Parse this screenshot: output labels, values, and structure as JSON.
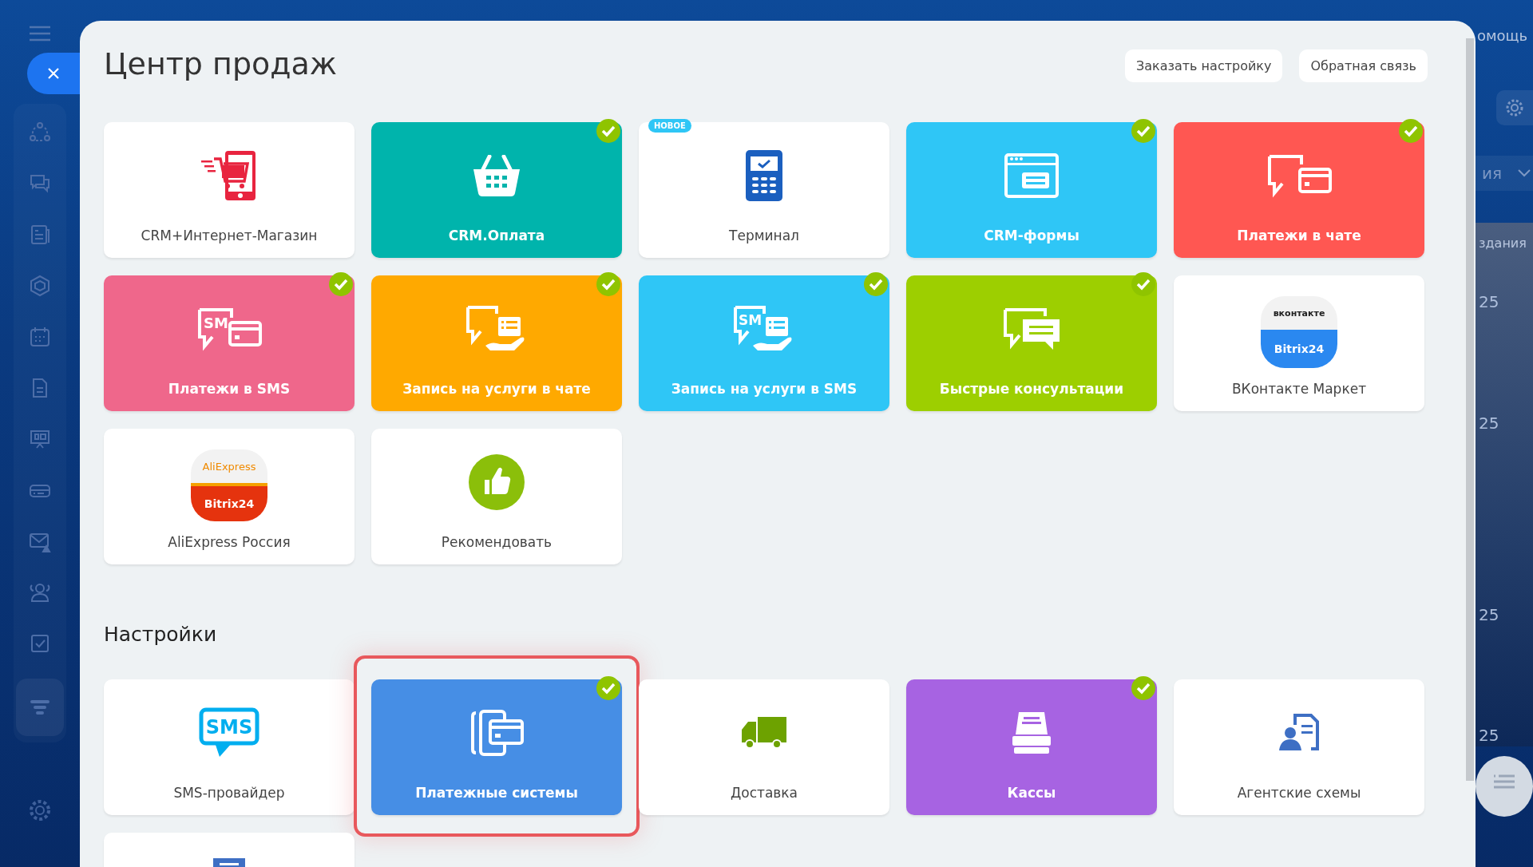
{
  "background": {
    "help_label": "омощь",
    "filter_label": "ия",
    "column_label": "здания",
    "dates": [
      "25",
      "25",
      "25",
      "25"
    ]
  },
  "sidebar": {
    "items": [
      {
        "selected": false
      },
      {
        "selected": false
      },
      {
        "selected": false
      },
      {
        "selected": false
      },
      {
        "selected": false
      },
      {
        "selected": false
      },
      {
        "selected": false
      },
      {
        "selected": false
      },
      {
        "selected": false
      },
      {
        "selected": false
      },
      {
        "selected": false
      },
      {
        "selected": true
      }
    ]
  },
  "panel": {
    "title": "Центр продаж",
    "buttons": [
      "Заказать настройку",
      "Обратная связь"
    ]
  },
  "sales": {
    "tiles": [
      {
        "label": "CRM+Интернет-Магазин",
        "color": "#ffffff",
        "checked": false
      },
      {
        "label": "CRM.Оплата",
        "color": "#00b4ac",
        "checked": true
      },
      {
        "label": "Терминал",
        "color": "#ffffff",
        "checked": false,
        "badge": "НОВОЕ"
      },
      {
        "label": "CRM-формы",
        "color": "#2fc6f6",
        "checked": true
      },
      {
        "label": "Платежи в чате",
        "color": "#ff5752",
        "checked": true
      },
      {
        "label": "Платежи в SMS",
        "color": "#ef678b",
        "checked": true,
        "icon_text": "SM"
      },
      {
        "label": "Запись на услуги в чате",
        "color": "#ffa900",
        "checked": true
      },
      {
        "label": "Запись на услуги в SMS",
        "color": "#2fc6f6",
        "checked": true,
        "icon_text": "SM"
      },
      {
        "label": "Быстрые консультации",
        "color": "#9dcf00",
        "checked": true
      },
      {
        "label": "ВКонтакте Маркет",
        "color": "#ffffff",
        "checked": false,
        "logo": {
          "top": "вконтакте",
          "bottom": "Bitrix24"
        }
      },
      {
        "label": "AliExpress Россия",
        "color": "#ffffff",
        "checked": false,
        "logo": {
          "top": "AliExpress",
          "bottom": "Bitrix24"
        }
      },
      {
        "label": "Рекомендовать",
        "color": "#ffffff",
        "checked": false
      }
    ]
  },
  "settings": {
    "title": "Настройки",
    "tiles": [
      {
        "label": "SMS-провайдер",
        "color": "#ffffff",
        "checked": false,
        "highlighted": false,
        "icon_text": "SMS"
      },
      {
        "label": "Платежные системы",
        "color": "#468ee5",
        "checked": true,
        "highlighted": true
      },
      {
        "label": "Доставка",
        "color": "#ffffff",
        "checked": false,
        "highlighted": false
      },
      {
        "label": "Кассы",
        "color": "#a763e2",
        "checked": true,
        "highlighted": false
      },
      {
        "label": "Агентские схемы",
        "color": "#ffffff",
        "checked": false,
        "highlighted": false
      },
      {
        "color": "#ffffff",
        "checked": false,
        "highlighted": false
      }
    ]
  }
}
